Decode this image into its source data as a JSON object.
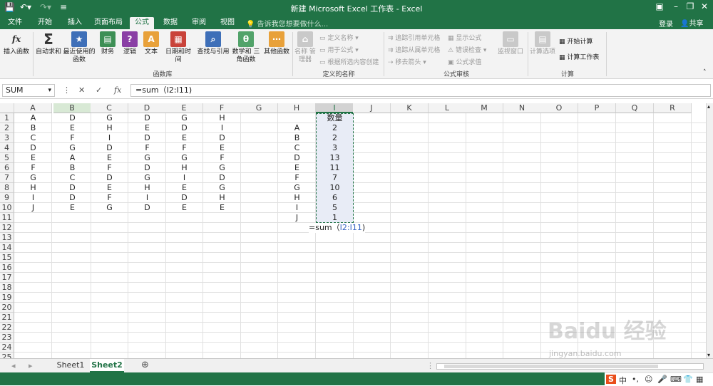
{
  "titlebar": {
    "title": "新建 Microsoft Excel 工作表 - Excel",
    "save_icon": "save-icon",
    "undo_icon": "undo-icon",
    "redo_icon": "redo-icon",
    "customize_icon": "customize-icon"
  },
  "tabs": [
    "文件",
    "开始",
    "插入",
    "页面布局",
    "公式",
    "数据",
    "审阅",
    "视图"
  ],
  "tell_me": "告诉我您想要做什么...",
  "login": "登录",
  "share": "共享",
  "ribbon": {
    "insert_function": "插入函数",
    "autosum": "自动求和",
    "recent": "最近使用的 函数",
    "financial": "财务",
    "logical": "逻辑",
    "text": "文本",
    "datetime": "日期和时间",
    "lookup": "查找与引用",
    "math": "数学和 三角函数",
    "more": "其他函数",
    "name_manager": "名称 管理器",
    "define_name": "定义名称",
    "use_in_formula": "用于公式",
    "create_from_sel": "根据所选内容创建",
    "trace_precedents": "追踪引用单元格",
    "trace_dependents": "追踪从属单元格",
    "remove_arrows": "移去箭头",
    "show_formulas": "显示公式",
    "error_checking": "错误检查",
    "evaluate": "公式求值",
    "watch": "监视窗口",
    "calc_options": "计算选项",
    "calc_now": "开始计算",
    "calc_sheet": "计算工作表",
    "group_library": "函数库",
    "group_names": "定义的名称",
    "group_audit": "公式审核",
    "group_calc": "计算"
  },
  "formula_bar": {
    "name_box": "SUM",
    "formula": "=sum（I2:I11)"
  },
  "columns": [
    "A",
    "B",
    "C",
    "D",
    "E",
    "F",
    "G",
    "H",
    "I",
    "J",
    "K",
    "L",
    "M",
    "N",
    "O",
    "P",
    "Q",
    "R"
  ],
  "rows": [
    "1",
    "2",
    "3",
    "4",
    "5",
    "6",
    "7",
    "8",
    "9",
    "10",
    "11",
    "12",
    "13",
    "14",
    "15",
    "16",
    "17",
    "18",
    "19",
    "20",
    "21",
    "22",
    "23",
    "24",
    "25"
  ],
  "sheet": {
    "A": [
      "A",
      "B",
      "C",
      "D",
      "E",
      "F",
      "G",
      "H",
      "I",
      "J"
    ],
    "B": [
      "D",
      "E",
      "F",
      "G",
      "A",
      "B",
      "C",
      "D",
      "D",
      "E"
    ],
    "C": [
      "G",
      "H",
      "I",
      "D",
      "E",
      "F",
      "D",
      "E",
      "F",
      "G"
    ],
    "D": [
      "D",
      "E",
      "D",
      "F",
      "G",
      "D",
      "G",
      "H",
      "I",
      "D"
    ],
    "E": [
      "G",
      "D",
      "E",
      "F",
      "G",
      "H",
      "I",
      "E",
      "D",
      "E"
    ],
    "F": [
      "H",
      "I",
      "D",
      "E",
      "F",
      "G",
      "D",
      "G",
      "H",
      "E"
    ],
    "H": [
      "A",
      "B",
      "C",
      "D",
      "E",
      "F",
      "G",
      "H",
      "I",
      "J"
    ],
    "I_header": "数量",
    "I": [
      "2",
      "2",
      "3",
      "13",
      "11",
      "7",
      "10",
      "6",
      "5",
      "1"
    ]
  },
  "editing_cell": {
    "prefix": "=sum（",
    "ref": "I2:I11",
    "suffix": ")"
  },
  "sheet_tabs": [
    "Sheet1",
    "Sheet2"
  ],
  "watermark": {
    "text": "Baidu 经验",
    "url": "jingyan.baidu.com"
  },
  "colors": {
    "accent": "#217346"
  }
}
